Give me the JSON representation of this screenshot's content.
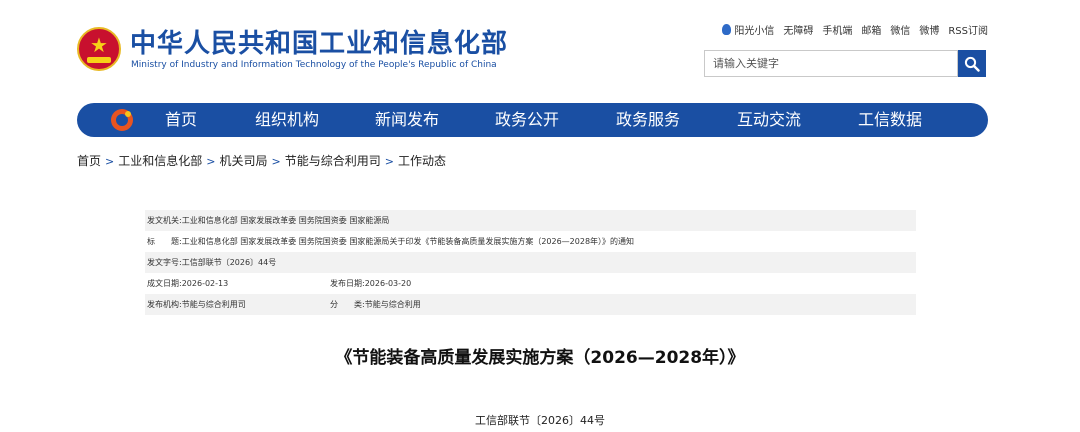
{
  "header": {
    "title": "中华人民共和国工业和信息化部",
    "subtitle": "Ministry of Industry and Information Technology of the People's Republic of China",
    "emblem_icon": "national-emblem-icon",
    "brand_color": "#1a4fa3"
  },
  "toplinks": {
    "items": [
      "阳光小信",
      "无障碍",
      "手机端",
      "邮箱",
      "微信",
      "微博",
      "RSS订阅"
    ]
  },
  "search": {
    "placeholder": "请输入关键字",
    "icon": "search-icon"
  },
  "nav": {
    "logo_icon": "ministry-logo-icon",
    "items": [
      "首页",
      "组织机构",
      "新闻发布",
      "政务公开",
      "政务服务",
      "互动交流",
      "工信数据"
    ]
  },
  "breadcrumb": {
    "items": [
      "首页",
      "工业和信息化部",
      "机关司局",
      "节能与综合利用司",
      "工作动态"
    ],
    "separator": ">"
  },
  "meta": {
    "issuer_label": "发文机关:",
    "issuer": "工业和信息化部 国家发展改革委 国务院国资委 国家能源局",
    "title_label": "标　　题:",
    "title": "工业和信息化部 国家发展改革委 国务院国资委 国家能源局关于印发《节能装备高质量发展实施方案（2026—2028年）》的通知",
    "docno_label": "发文字号:",
    "docno": "工信部联节〔2026〕44号",
    "created_label": "成文日期:",
    "created": "2026-02-13",
    "published_label": "发布日期:",
    "published": "2026-03-20",
    "org_label": "发布机构:",
    "org": "节能与综合利用司",
    "category_label": "分　　类:",
    "category": "节能与综合利用"
  },
  "document": {
    "title": "《节能装备高质量发展实施方案（2026—2028年）》",
    "number": "工信部联节〔2026〕44号"
  }
}
